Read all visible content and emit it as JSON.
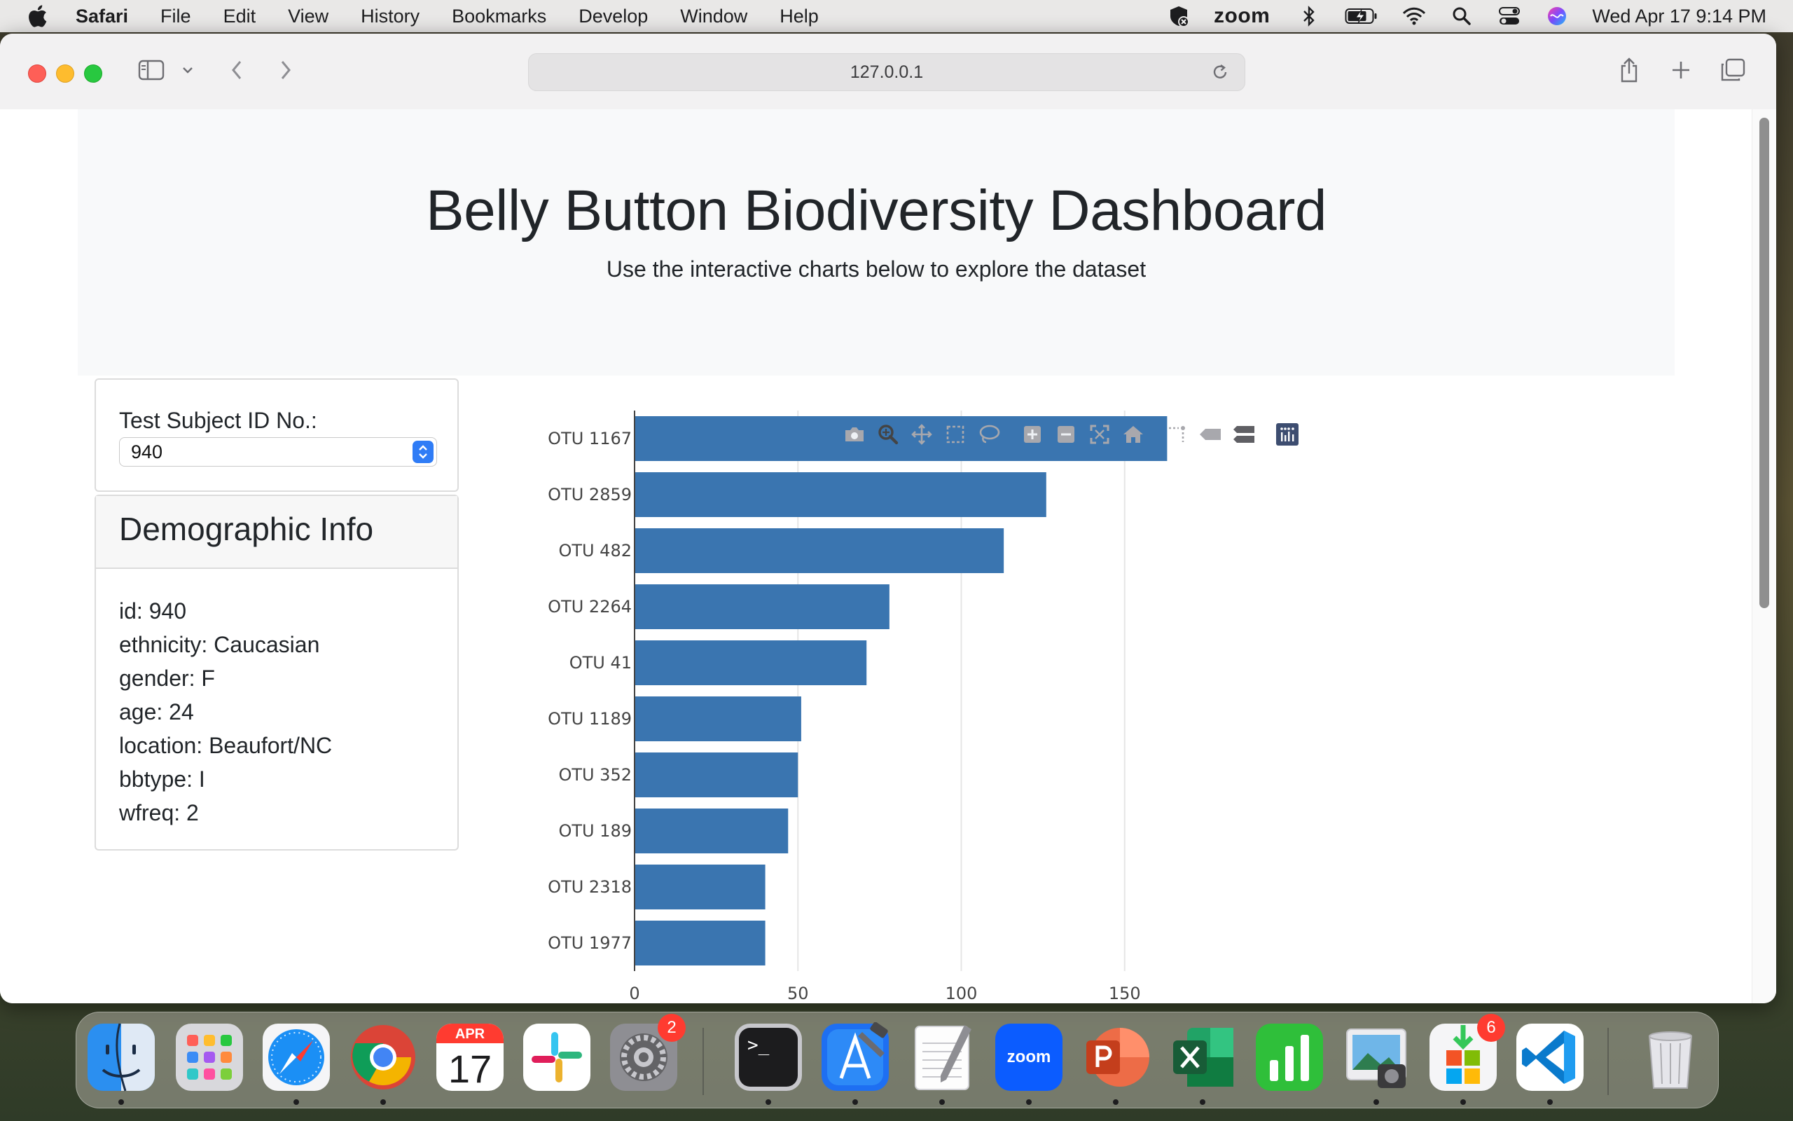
{
  "menubar": {
    "app_name": "Safari",
    "items": [
      "File",
      "Edit",
      "View",
      "History",
      "Bookmarks",
      "Develop",
      "Window",
      "Help"
    ],
    "zoom_label": "zoom",
    "clock": "Wed Apr 17  9:14 PM"
  },
  "browser": {
    "address": "127.0.0.1"
  },
  "page": {
    "title": "Belly Button Biodiversity Dashboard",
    "subtitle": "Use the interactive charts below to explore the dataset",
    "selector_label": "Test Subject ID No.:",
    "selected_id": "940",
    "demographic_title": "Demographic Info",
    "demographics": [
      "id: 940",
      "ethnicity: Caucasian",
      "gender: F",
      "age: 24",
      "location: Beaufort/NC",
      "bbtype: I",
      "wfreq: 2"
    ]
  },
  "chart_data": {
    "type": "bar",
    "orientation": "horizontal",
    "categories": [
      "OTU 1167",
      "OTU 2859",
      "OTU 482",
      "OTU 2264",
      "OTU 41",
      "OTU 1189",
      "OTU 352",
      "OTU 189",
      "OTU 2318",
      "OTU 1977"
    ],
    "values": [
      163,
      126,
      113,
      78,
      71,
      51,
      50,
      47,
      40,
      40
    ],
    "xlim": [
      0,
      175
    ],
    "xticks": [
      "0",
      "50",
      "100",
      "150"
    ],
    "grid": true,
    "bar_color": "#3a75b0"
  },
  "modebar_icons": [
    "camera-icon",
    "zoom-icon",
    "pan-icon",
    "box-select-icon",
    "lasso-select-icon",
    "zoom-in-icon",
    "zoom-out-icon",
    "autoscale-icon",
    "reset-axes-icon",
    "spike-lines-icon",
    "hover-closest-icon",
    "hover-compare-icon",
    "plotly-logo-icon"
  ],
  "dock": {
    "apps": [
      "Finder",
      "Launchpad",
      "Safari",
      "Google Chrome",
      "Calendar",
      "Slack",
      "System Settings",
      "Terminal",
      "Xcode",
      "TextEdit",
      "Zoom",
      "PowerPoint",
      "Excel",
      "Numbers",
      "Preview",
      "App Store",
      "Visual Studio Code",
      "Trash"
    ],
    "calendar_month": "APR",
    "calendar_day": "17",
    "settings_badge": "2",
    "appstore_badge": "6",
    "zoom_tile_text": "zoom",
    "terminal_prompt": ">_"
  }
}
